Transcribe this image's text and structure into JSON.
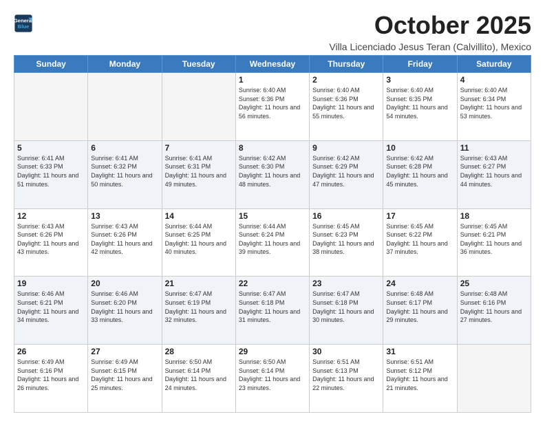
{
  "header": {
    "logo_line1": "General",
    "logo_line2": "Blue",
    "main_title": "October 2025",
    "subtitle": "Villa Licenciado Jesus Teran (Calvillito), Mexico"
  },
  "weekdays": [
    "Sunday",
    "Monday",
    "Tuesday",
    "Wednesday",
    "Thursday",
    "Friday",
    "Saturday"
  ],
  "weeks": [
    [
      {
        "day": "",
        "info": ""
      },
      {
        "day": "",
        "info": ""
      },
      {
        "day": "",
        "info": ""
      },
      {
        "day": "1",
        "info": "Sunrise: 6:40 AM\nSunset: 6:36 PM\nDaylight: 11 hours and 56 minutes."
      },
      {
        "day": "2",
        "info": "Sunrise: 6:40 AM\nSunset: 6:36 PM\nDaylight: 11 hours and 55 minutes."
      },
      {
        "day": "3",
        "info": "Sunrise: 6:40 AM\nSunset: 6:35 PM\nDaylight: 11 hours and 54 minutes."
      },
      {
        "day": "4",
        "info": "Sunrise: 6:40 AM\nSunset: 6:34 PM\nDaylight: 11 hours and 53 minutes."
      }
    ],
    [
      {
        "day": "5",
        "info": "Sunrise: 6:41 AM\nSunset: 6:33 PM\nDaylight: 11 hours and 51 minutes."
      },
      {
        "day": "6",
        "info": "Sunrise: 6:41 AM\nSunset: 6:32 PM\nDaylight: 11 hours and 50 minutes."
      },
      {
        "day": "7",
        "info": "Sunrise: 6:41 AM\nSunset: 6:31 PM\nDaylight: 11 hours and 49 minutes."
      },
      {
        "day": "8",
        "info": "Sunrise: 6:42 AM\nSunset: 6:30 PM\nDaylight: 11 hours and 48 minutes."
      },
      {
        "day": "9",
        "info": "Sunrise: 6:42 AM\nSunset: 6:29 PM\nDaylight: 11 hours and 47 minutes."
      },
      {
        "day": "10",
        "info": "Sunrise: 6:42 AM\nSunset: 6:28 PM\nDaylight: 11 hours and 45 minutes."
      },
      {
        "day": "11",
        "info": "Sunrise: 6:43 AM\nSunset: 6:27 PM\nDaylight: 11 hours and 44 minutes."
      }
    ],
    [
      {
        "day": "12",
        "info": "Sunrise: 6:43 AM\nSunset: 6:26 PM\nDaylight: 11 hours and 43 minutes."
      },
      {
        "day": "13",
        "info": "Sunrise: 6:43 AM\nSunset: 6:26 PM\nDaylight: 11 hours and 42 minutes."
      },
      {
        "day": "14",
        "info": "Sunrise: 6:44 AM\nSunset: 6:25 PM\nDaylight: 11 hours and 40 minutes."
      },
      {
        "day": "15",
        "info": "Sunrise: 6:44 AM\nSunset: 6:24 PM\nDaylight: 11 hours and 39 minutes."
      },
      {
        "day": "16",
        "info": "Sunrise: 6:45 AM\nSunset: 6:23 PM\nDaylight: 11 hours and 38 minutes."
      },
      {
        "day": "17",
        "info": "Sunrise: 6:45 AM\nSunset: 6:22 PM\nDaylight: 11 hours and 37 minutes."
      },
      {
        "day": "18",
        "info": "Sunrise: 6:45 AM\nSunset: 6:21 PM\nDaylight: 11 hours and 36 minutes."
      }
    ],
    [
      {
        "day": "19",
        "info": "Sunrise: 6:46 AM\nSunset: 6:21 PM\nDaylight: 11 hours and 34 minutes."
      },
      {
        "day": "20",
        "info": "Sunrise: 6:46 AM\nSunset: 6:20 PM\nDaylight: 11 hours and 33 minutes."
      },
      {
        "day": "21",
        "info": "Sunrise: 6:47 AM\nSunset: 6:19 PM\nDaylight: 11 hours and 32 minutes."
      },
      {
        "day": "22",
        "info": "Sunrise: 6:47 AM\nSunset: 6:18 PM\nDaylight: 11 hours and 31 minutes."
      },
      {
        "day": "23",
        "info": "Sunrise: 6:47 AM\nSunset: 6:18 PM\nDaylight: 11 hours and 30 minutes."
      },
      {
        "day": "24",
        "info": "Sunrise: 6:48 AM\nSunset: 6:17 PM\nDaylight: 11 hours and 29 minutes."
      },
      {
        "day": "25",
        "info": "Sunrise: 6:48 AM\nSunset: 6:16 PM\nDaylight: 11 hours and 27 minutes."
      }
    ],
    [
      {
        "day": "26",
        "info": "Sunrise: 6:49 AM\nSunset: 6:16 PM\nDaylight: 11 hours and 26 minutes."
      },
      {
        "day": "27",
        "info": "Sunrise: 6:49 AM\nSunset: 6:15 PM\nDaylight: 11 hours and 25 minutes."
      },
      {
        "day": "28",
        "info": "Sunrise: 6:50 AM\nSunset: 6:14 PM\nDaylight: 11 hours and 24 minutes."
      },
      {
        "day": "29",
        "info": "Sunrise: 6:50 AM\nSunset: 6:14 PM\nDaylight: 11 hours and 23 minutes."
      },
      {
        "day": "30",
        "info": "Sunrise: 6:51 AM\nSunset: 6:13 PM\nDaylight: 11 hours and 22 minutes."
      },
      {
        "day": "31",
        "info": "Sunrise: 6:51 AM\nSunset: 6:12 PM\nDaylight: 11 hours and 21 minutes."
      },
      {
        "day": "",
        "info": ""
      }
    ]
  ]
}
